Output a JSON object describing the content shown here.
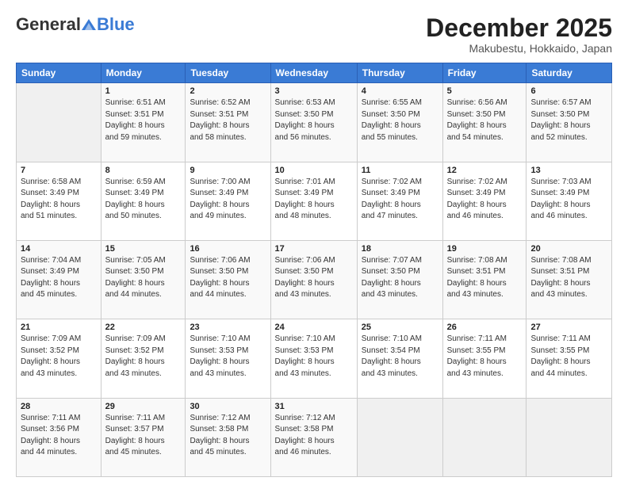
{
  "header": {
    "logo_general": "General",
    "logo_blue": "Blue",
    "month_title": "December 2025",
    "location": "Makubestu, Hokkaido, Japan"
  },
  "weekdays": [
    "Sunday",
    "Monday",
    "Tuesday",
    "Wednesday",
    "Thursday",
    "Friday",
    "Saturday"
  ],
  "weeks": [
    [
      {
        "day": "",
        "info": ""
      },
      {
        "day": "1",
        "info": "Sunrise: 6:51 AM\nSunset: 3:51 PM\nDaylight: 8 hours\nand 59 minutes."
      },
      {
        "day": "2",
        "info": "Sunrise: 6:52 AM\nSunset: 3:51 PM\nDaylight: 8 hours\nand 58 minutes."
      },
      {
        "day": "3",
        "info": "Sunrise: 6:53 AM\nSunset: 3:50 PM\nDaylight: 8 hours\nand 56 minutes."
      },
      {
        "day": "4",
        "info": "Sunrise: 6:55 AM\nSunset: 3:50 PM\nDaylight: 8 hours\nand 55 minutes."
      },
      {
        "day": "5",
        "info": "Sunrise: 6:56 AM\nSunset: 3:50 PM\nDaylight: 8 hours\nand 54 minutes."
      },
      {
        "day": "6",
        "info": "Sunrise: 6:57 AM\nSunset: 3:50 PM\nDaylight: 8 hours\nand 52 minutes."
      }
    ],
    [
      {
        "day": "7",
        "info": "Sunrise: 6:58 AM\nSunset: 3:49 PM\nDaylight: 8 hours\nand 51 minutes."
      },
      {
        "day": "8",
        "info": "Sunrise: 6:59 AM\nSunset: 3:49 PM\nDaylight: 8 hours\nand 50 minutes."
      },
      {
        "day": "9",
        "info": "Sunrise: 7:00 AM\nSunset: 3:49 PM\nDaylight: 8 hours\nand 49 minutes."
      },
      {
        "day": "10",
        "info": "Sunrise: 7:01 AM\nSunset: 3:49 PM\nDaylight: 8 hours\nand 48 minutes."
      },
      {
        "day": "11",
        "info": "Sunrise: 7:02 AM\nSunset: 3:49 PM\nDaylight: 8 hours\nand 47 minutes."
      },
      {
        "day": "12",
        "info": "Sunrise: 7:02 AM\nSunset: 3:49 PM\nDaylight: 8 hours\nand 46 minutes."
      },
      {
        "day": "13",
        "info": "Sunrise: 7:03 AM\nSunset: 3:49 PM\nDaylight: 8 hours\nand 46 minutes."
      }
    ],
    [
      {
        "day": "14",
        "info": "Sunrise: 7:04 AM\nSunset: 3:49 PM\nDaylight: 8 hours\nand 45 minutes."
      },
      {
        "day": "15",
        "info": "Sunrise: 7:05 AM\nSunset: 3:50 PM\nDaylight: 8 hours\nand 44 minutes."
      },
      {
        "day": "16",
        "info": "Sunrise: 7:06 AM\nSunset: 3:50 PM\nDaylight: 8 hours\nand 44 minutes."
      },
      {
        "day": "17",
        "info": "Sunrise: 7:06 AM\nSunset: 3:50 PM\nDaylight: 8 hours\nand 43 minutes."
      },
      {
        "day": "18",
        "info": "Sunrise: 7:07 AM\nSunset: 3:50 PM\nDaylight: 8 hours\nand 43 minutes."
      },
      {
        "day": "19",
        "info": "Sunrise: 7:08 AM\nSunset: 3:51 PM\nDaylight: 8 hours\nand 43 minutes."
      },
      {
        "day": "20",
        "info": "Sunrise: 7:08 AM\nSunset: 3:51 PM\nDaylight: 8 hours\nand 43 minutes."
      }
    ],
    [
      {
        "day": "21",
        "info": "Sunrise: 7:09 AM\nSunset: 3:52 PM\nDaylight: 8 hours\nand 43 minutes."
      },
      {
        "day": "22",
        "info": "Sunrise: 7:09 AM\nSunset: 3:52 PM\nDaylight: 8 hours\nand 43 minutes."
      },
      {
        "day": "23",
        "info": "Sunrise: 7:10 AM\nSunset: 3:53 PM\nDaylight: 8 hours\nand 43 minutes."
      },
      {
        "day": "24",
        "info": "Sunrise: 7:10 AM\nSunset: 3:53 PM\nDaylight: 8 hours\nand 43 minutes."
      },
      {
        "day": "25",
        "info": "Sunrise: 7:10 AM\nSunset: 3:54 PM\nDaylight: 8 hours\nand 43 minutes."
      },
      {
        "day": "26",
        "info": "Sunrise: 7:11 AM\nSunset: 3:55 PM\nDaylight: 8 hours\nand 43 minutes."
      },
      {
        "day": "27",
        "info": "Sunrise: 7:11 AM\nSunset: 3:55 PM\nDaylight: 8 hours\nand 44 minutes."
      }
    ],
    [
      {
        "day": "28",
        "info": "Sunrise: 7:11 AM\nSunset: 3:56 PM\nDaylight: 8 hours\nand 44 minutes."
      },
      {
        "day": "29",
        "info": "Sunrise: 7:11 AM\nSunset: 3:57 PM\nDaylight: 8 hours\nand 45 minutes."
      },
      {
        "day": "30",
        "info": "Sunrise: 7:12 AM\nSunset: 3:58 PM\nDaylight: 8 hours\nand 45 minutes."
      },
      {
        "day": "31",
        "info": "Sunrise: 7:12 AM\nSunset: 3:58 PM\nDaylight: 8 hours\nand 46 minutes."
      },
      {
        "day": "",
        "info": ""
      },
      {
        "day": "",
        "info": ""
      },
      {
        "day": "",
        "info": ""
      }
    ]
  ]
}
